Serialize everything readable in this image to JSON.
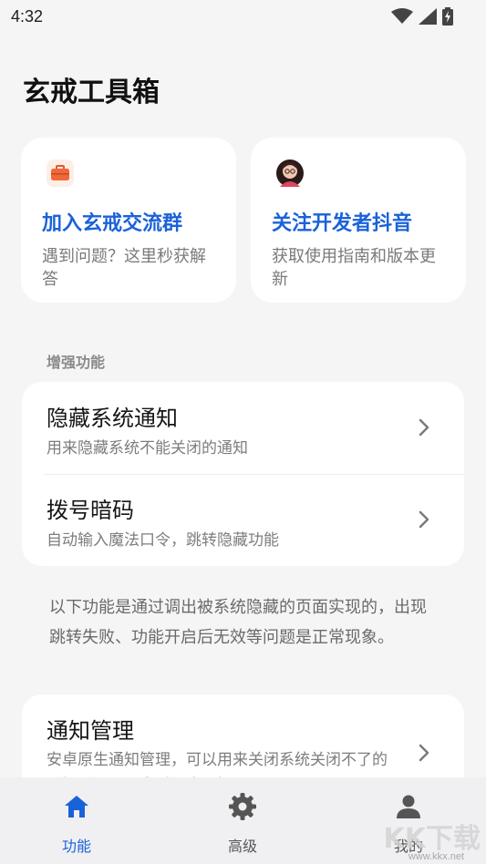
{
  "status_bar": {
    "time": "4:32",
    "icons": [
      "wifi-icon",
      "signal-icon",
      "battery-charging-icon"
    ]
  },
  "page": {
    "title": "玄戒工具箱"
  },
  "top_cards": [
    {
      "icon": "toolbox-icon",
      "title": "加入玄戒交流群",
      "subtitle": "遇到问题？这里秒获解答"
    },
    {
      "icon": "avatar-icon",
      "title": "关注开发者抖音",
      "subtitle": "获取使用指南和版本更新"
    }
  ],
  "enhance_section": {
    "label": "增强功能",
    "items": [
      {
        "title": "隐藏系统通知",
        "desc": "用来隐藏系统不能关闭的通知"
      },
      {
        "title": "拨号暗码",
        "desc": "自动输入魔法口令，跳转隐藏功能"
      }
    ]
  },
  "note": {
    "text": "以下功能是通过调出被系统隐藏的页面实现的，出现跳转失败、功能开启后无效等问题是正常现象。"
  },
  "hidden_section": {
    "items": [
      {
        "title": "通知管理",
        "desc": "安卓原生通知管理，可以用来关闭系统关闭不了的通知，还可以查看历史通知"
      }
    ]
  },
  "bottom_nav": {
    "tabs": [
      {
        "label": "功能",
        "icon": "home-icon",
        "active": true
      },
      {
        "label": "高级",
        "icon": "gear-icon",
        "active": false
      },
      {
        "label": "我的",
        "icon": "person-icon",
        "active": false
      }
    ]
  },
  "colors": {
    "accent": "#1a62d9",
    "background": "#f5f5f5",
    "card": "#ffffff"
  },
  "watermark": {
    "text": "KK下载",
    "url": "www.kkx.net"
  }
}
